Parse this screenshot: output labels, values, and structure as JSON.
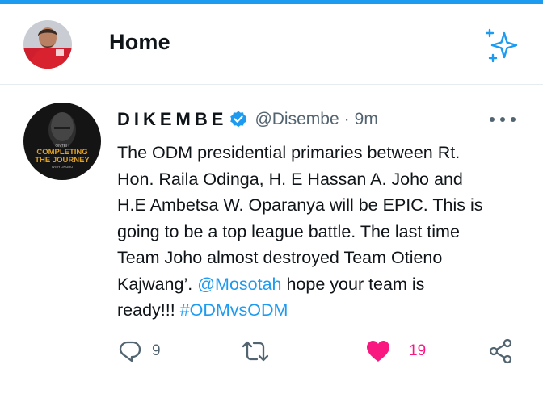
{
  "header": {
    "title": "Home"
  },
  "tweet": {
    "author_name": "DIKEMBE",
    "handle": "@Disembe",
    "separator": "·",
    "time": "9m",
    "avatar_text": {
      "line1": "ONTEH",
      "line2": "COMPLETING",
      "line3": "THE JOURNEY",
      "line4": "WITH LINURU"
    },
    "body": {
      "line1": "The ODM presidential primaries between Rt.",
      "line2": "Hon. Raila Odinga, H. E Hassan A. Joho and",
      "line3": "H.E Ambetsa W. Oparanya will be EPIC. This is",
      "line4": "going to be a top league battle. The last time",
      "line5": "Team Joho almost destroyed Team Otieno",
      "line6": "Kajwang’. ",
      "mention": "@Mosotah",
      "line6_rest": " hope your team is",
      "line7": "ready!!! ",
      "hashtag": "#ODMvsODM"
    },
    "stats": {
      "replies": "9",
      "likes": "19"
    }
  },
  "colors": {
    "accent": "#1d9bf0",
    "like": "#f91880",
    "muted": "#536471",
    "text": "#0f1419"
  },
  "icons": {
    "verified": "verified-badge-icon",
    "sparkle": "sparkle-icon",
    "reply": "reply-icon",
    "retweet": "retweet-icon",
    "like": "heart-icon",
    "share": "share-icon",
    "more": "more-icon"
  }
}
